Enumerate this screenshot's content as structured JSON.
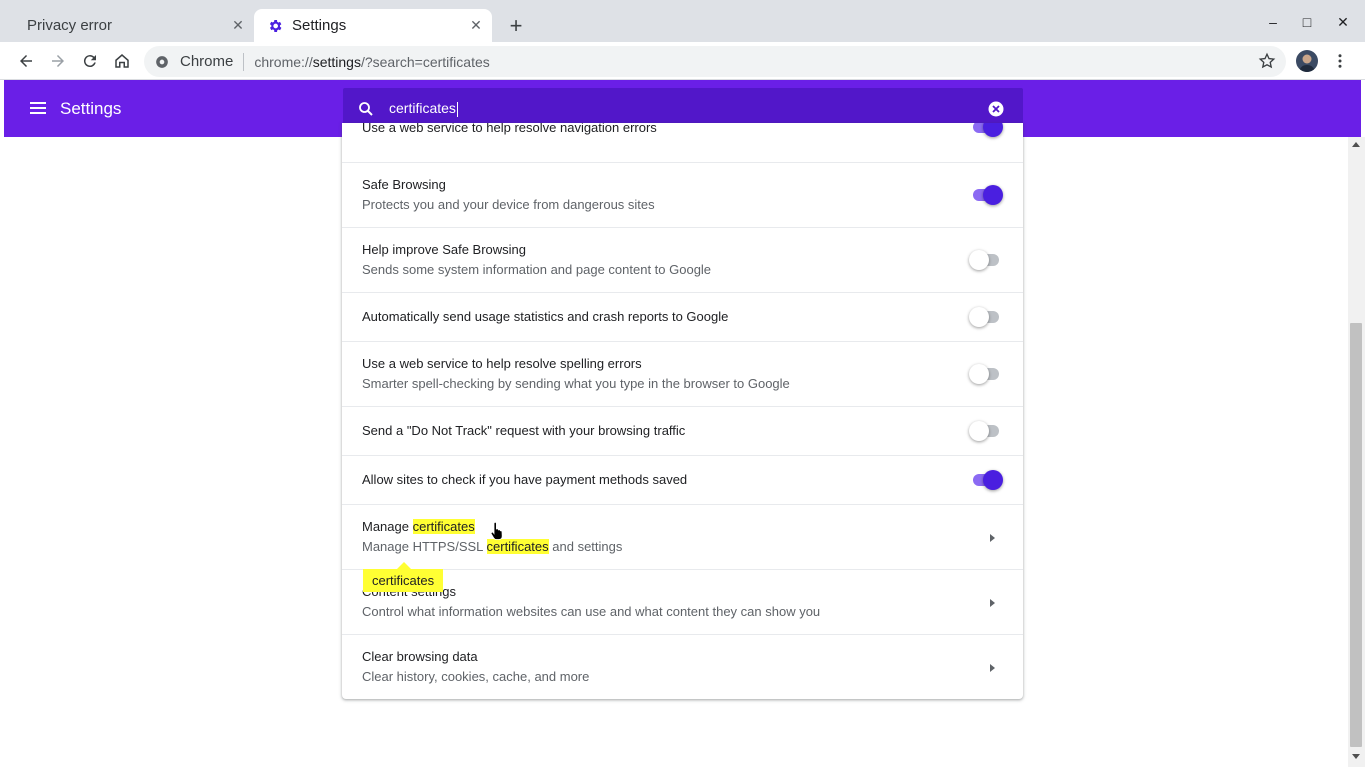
{
  "browser": {
    "tabs": [
      {
        "title": "Privacy error",
        "active": false,
        "close": "✕"
      },
      {
        "title": "Settings",
        "active": true,
        "close": "✕"
      }
    ],
    "new_tab": "+",
    "window_controls": {
      "minimize": "–",
      "maximize": "□",
      "close": "✕"
    },
    "omnibox": {
      "chip": "Chrome",
      "url_scheme": "chrome://",
      "url_host": "settings",
      "url_rest": "/?search=certificates"
    }
  },
  "header": {
    "title": "Settings",
    "search_value": "certificates"
  },
  "rows": [
    {
      "primary": "Use a web service to help resolve navigation errors",
      "toggle": "on"
    },
    {
      "primary": "Safe Browsing",
      "secondary": "Protects you and your device from dangerous sites",
      "toggle": "on"
    },
    {
      "primary": "Help improve Safe Browsing",
      "secondary": "Sends some system information and page content to Google",
      "toggle": "off"
    },
    {
      "primary": "Automatically send usage statistics and crash reports to Google",
      "toggle": "off"
    },
    {
      "primary": "Use a web service to help resolve spelling errors",
      "secondary": "Smarter spell-checking by sending what you type in the browser to Google",
      "toggle": "off"
    },
    {
      "primary": "Send a \"Do Not Track\" request with your browsing traffic",
      "toggle": "off"
    },
    {
      "primary": "Allow sites to check if you have payment methods saved",
      "toggle": "on"
    },
    {
      "primary_prefix": "Manage ",
      "primary_highlight": "certificates",
      "secondary_prefix": "Manage HTTPS/SSL ",
      "secondary_highlight": "certificates",
      "secondary_suffix": " and settings"
    },
    {
      "primary": "Content settings",
      "secondary": "Control what information websites can use and what content they can show you"
    },
    {
      "primary": "Clear browsing data",
      "secondary": "Clear history, cookies, cache, and more"
    }
  ],
  "search_bubble": "certificates",
  "colors": {
    "accent": "#6a1fe7",
    "search_bg": "#5217c9",
    "highlight": "#ffff33",
    "toggle_on": "#4a1fe0"
  }
}
